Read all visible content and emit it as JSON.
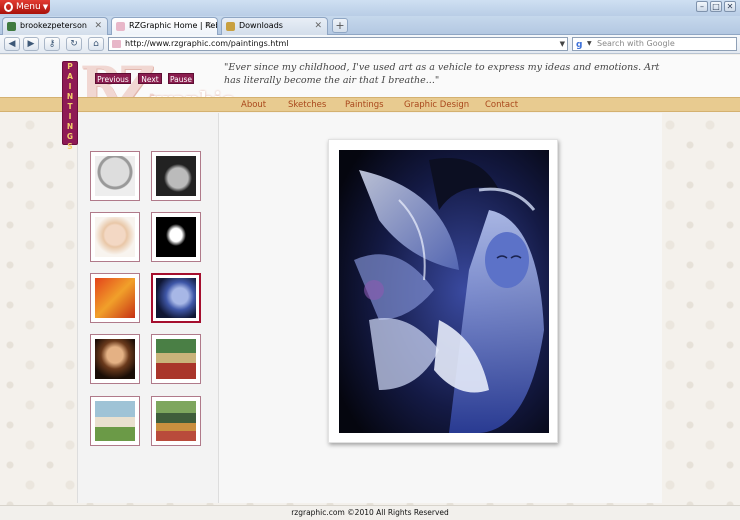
{
  "browser": {
    "menu_label": "Menu",
    "tabs": [
      {
        "label": "brookezpeterson",
        "color": "#3f7a3f"
      },
      {
        "label": "RZGraphic Home | Reb...",
        "color": "#e8b7c9"
      },
      {
        "label": "Downloads",
        "color": "#c8a040"
      }
    ],
    "url": "http://www.rzgraphic.com/paintings.html",
    "search_placeholder": "Search with Google"
  },
  "site": {
    "logo_main": "RZ",
    "logo_sub": "graphic",
    "quote": "\"Ever since my childhood, I've used art as a vehicle to express my ideas and emotions. Art has literally become the air that I breathe...\"",
    "nav": [
      "About",
      "Sketches",
      "Paintings",
      "Graphic Design",
      "Contact"
    ],
    "section_tag": "PAINTINGS",
    "controls": {
      "previous": "Previous",
      "next": "Next",
      "pause": "Pause"
    },
    "footer": "rzgraphic.com ©2010 All Rights Reserved"
  },
  "colors": {
    "nav_band": "#e8cb90",
    "nav_link": "#a9481c",
    "accent": "#8a1d4e"
  }
}
